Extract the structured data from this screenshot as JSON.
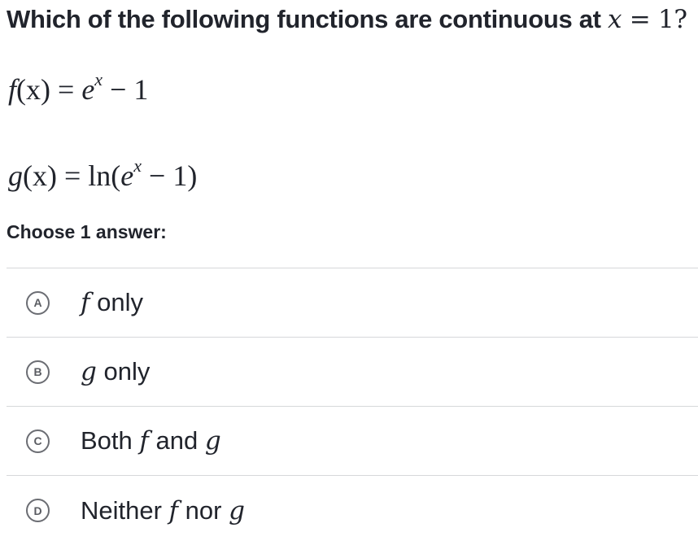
{
  "question": {
    "prefix": "Which of the following functions are continuous at ",
    "var": "x",
    "equals_value": " = 1",
    "suffix": "?"
  },
  "equations": {
    "f": {
      "lhs": "f",
      "arg": "(x)",
      "rel": " = ",
      "base": "e",
      "exp": "x",
      "rest": " − 1"
    },
    "g": {
      "lhs": "g",
      "arg": "(x)",
      "rel": " = ",
      "func": "ln(",
      "base": "e",
      "exp": "x",
      "rest": " − 1)"
    }
  },
  "choose_label": "Choose 1 answer:",
  "choices": [
    {
      "letter": "A",
      "parts": [
        "f",
        " only"
      ]
    },
    {
      "letter": "B",
      "parts": [
        "g",
        " only"
      ]
    },
    {
      "letter": "C",
      "parts": [
        "Both ",
        "f",
        " and ",
        "g"
      ]
    },
    {
      "letter": "D",
      "parts": [
        "Neither ",
        "f",
        " nor ",
        "g"
      ]
    }
  ]
}
